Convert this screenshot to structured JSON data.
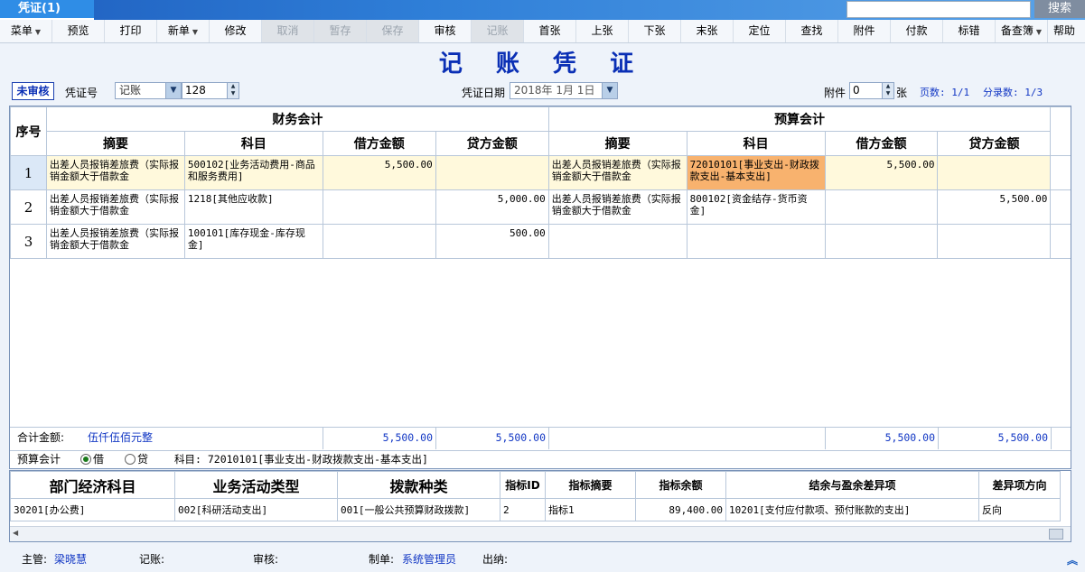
{
  "header": {
    "tab_label": "凭证(1)",
    "search_value": "",
    "search_button": "搜索"
  },
  "toolbar": [
    {
      "label": "菜单",
      "dropdown": true,
      "disabled": false
    },
    {
      "label": "预览",
      "dropdown": false,
      "disabled": false
    },
    {
      "label": "打印",
      "dropdown": false,
      "disabled": false
    },
    {
      "label": "新单",
      "dropdown": true,
      "disabled": false
    },
    {
      "label": "修改",
      "dropdown": false,
      "disabled": false
    },
    {
      "label": "取消",
      "dropdown": false,
      "disabled": true
    },
    {
      "label": "暂存",
      "dropdown": false,
      "disabled": true
    },
    {
      "label": "保存",
      "dropdown": false,
      "disabled": true
    },
    {
      "label": "审核",
      "dropdown": false,
      "disabled": false
    },
    {
      "label": "记账",
      "dropdown": false,
      "disabled": true
    },
    {
      "label": "首张",
      "dropdown": false,
      "disabled": false
    },
    {
      "label": "上张",
      "dropdown": false,
      "disabled": false
    },
    {
      "label": "下张",
      "dropdown": false,
      "disabled": false
    },
    {
      "label": "末张",
      "dropdown": false,
      "disabled": false
    },
    {
      "label": "定位",
      "dropdown": false,
      "disabled": false
    },
    {
      "label": "查找",
      "dropdown": false,
      "disabled": false
    },
    {
      "label": "附件",
      "dropdown": false,
      "disabled": false
    },
    {
      "label": "付款",
      "dropdown": false,
      "disabled": false
    },
    {
      "label": "标错",
      "dropdown": false,
      "disabled": false
    },
    {
      "label": "备查簿",
      "dropdown": true,
      "disabled": false
    },
    {
      "label": "帮助",
      "dropdown": false,
      "disabled": false
    }
  ],
  "voucher": {
    "title": "记 账 凭 证",
    "status": "未审核",
    "voucher_no_label": "凭证号",
    "voucher_type": "记账",
    "voucher_no": "128",
    "date_label": "凭证日期",
    "date_value": "2018年 1月 1日",
    "attachment_label": "附件",
    "attachment_count": "0",
    "attachment_unit": "张",
    "page_info": "页数: 1/1",
    "entry_info": "分录数: 1/3"
  },
  "grid": {
    "seq_header": "序号",
    "group_finance": "财务会计",
    "group_budget": "预算会计",
    "col_summary": "摘要",
    "col_account": "科目",
    "col_debit": "借方金额",
    "col_credit": "贷方金额",
    "rows": [
      {
        "seq": "1",
        "f_summary": "出差人员报销差旅费（实际报销金额大于借款金",
        "f_account": "500102[业务活动费用-商品和服务费用]",
        "f_debit": "5,500.00",
        "f_credit": "",
        "b_summary": "出差人员报销差旅费（实际报销金额大于借款金",
        "b_account": "72010101[事业支出-财政拨款支出-基本支出]",
        "b_debit": "5,500.00",
        "b_credit": ""
      },
      {
        "seq": "2",
        "f_summary": "出差人员报销差旅费（实际报销金额大于借款金",
        "f_account": "1218[其他应收款]",
        "f_debit": "",
        "f_credit": "5,000.00",
        "b_summary": "出差人员报销差旅费（实际报销金额大于借款金",
        "b_account": "800102[资金结存-货币资金]",
        "b_debit": "",
        "b_credit": "5,500.00"
      },
      {
        "seq": "3",
        "f_summary": "出差人员报销差旅费（实际报销金额大于借款金",
        "f_account": "100101[库存现金-库存现金]",
        "f_debit": "",
        "f_credit": "500.00",
        "b_summary": "",
        "b_account": "",
        "b_debit": "",
        "b_credit": ""
      }
    ],
    "total_label": "合计金额:",
    "total_words": "伍仟伍佰元整",
    "total_f_debit": "5,500.00",
    "total_f_credit": "5,500.00",
    "total_b_debit": "5,500.00",
    "total_b_credit": "5,500.00"
  },
  "budget_line": {
    "label": "预算会计",
    "radio_debit": "借",
    "radio_credit": "贷",
    "account_label": "科目: 72010101[事业支出-财政拨款支出-基本支出]"
  },
  "detail": {
    "headers": [
      "部门经济科目",
      "业务活动类型",
      "拨款种类",
      "指标ID",
      "指标摘要",
      "指标余额",
      "结余与盈余差异项",
      "差异项方向"
    ],
    "row": [
      "30201[办公费]",
      "002[科研活动支出]",
      "001[一般公共预算财政拨款]",
      "2",
      "指标1",
      "89,400.00",
      "10201[支付应付款项、预付账款的支出]",
      "反向"
    ]
  },
  "footer": {
    "supervisor_label": "主管:",
    "supervisor": "梁晓慧",
    "bookkeeper_label": "记账:",
    "reviewer_label": "审核:",
    "maker_label": "制单:",
    "maker": "系统管理员",
    "cashier_label": "出纳:"
  }
}
